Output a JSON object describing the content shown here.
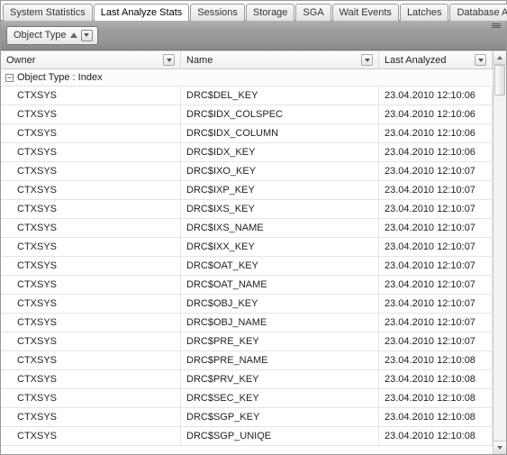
{
  "tabs": [
    {
      "label": "System Statistics",
      "active": false
    },
    {
      "label": "Last Analyze Stats",
      "active": true
    },
    {
      "label": "Sessions",
      "active": false
    },
    {
      "label": "Storage",
      "active": false
    },
    {
      "label": "SGA",
      "active": false
    },
    {
      "label": "Wait Events",
      "active": false
    },
    {
      "label": "Latches",
      "active": false
    },
    {
      "label": "Database Alerts",
      "active": false
    }
  ],
  "toolbar": {
    "group_button_label": "Object Type"
  },
  "columns": {
    "owner": "Owner",
    "name": "Name",
    "last_analyzed": "Last Analyzed"
  },
  "group": {
    "header": "Object Type : Index",
    "collapse_glyph": "⊟"
  },
  "rows": [
    {
      "owner": "CTXSYS",
      "name": "DRC$DEL_KEY",
      "last": "23.04.2010 12:10:06"
    },
    {
      "owner": "CTXSYS",
      "name": "DRC$IDX_COLSPEC",
      "last": "23.04.2010 12:10:06"
    },
    {
      "owner": "CTXSYS",
      "name": "DRC$IDX_COLUMN",
      "last": "23.04.2010 12:10:06"
    },
    {
      "owner": "CTXSYS",
      "name": "DRC$IDX_KEY",
      "last": "23.04.2010 12:10:06"
    },
    {
      "owner": "CTXSYS",
      "name": "DRC$IXO_KEY",
      "last": "23.04.2010 12:10:07"
    },
    {
      "owner": "CTXSYS",
      "name": "DRC$IXP_KEY",
      "last": "23.04.2010 12:10:07"
    },
    {
      "owner": "CTXSYS",
      "name": "DRC$IXS_KEY",
      "last": "23.04.2010 12:10:07"
    },
    {
      "owner": "CTXSYS",
      "name": "DRC$IXS_NAME",
      "last": "23.04.2010 12:10:07"
    },
    {
      "owner": "CTXSYS",
      "name": "DRC$IXX_KEY",
      "last": "23.04.2010 12:10:07"
    },
    {
      "owner": "CTXSYS",
      "name": "DRC$OAT_KEY",
      "last": "23.04.2010 12:10:07"
    },
    {
      "owner": "CTXSYS",
      "name": "DRC$OAT_NAME",
      "last": "23.04.2010 12:10:07"
    },
    {
      "owner": "CTXSYS",
      "name": "DRC$OBJ_KEY",
      "last": "23.04.2010 12:10:07"
    },
    {
      "owner": "CTXSYS",
      "name": "DRC$OBJ_NAME",
      "last": "23.04.2010 12:10:07"
    },
    {
      "owner": "CTXSYS",
      "name": "DRC$PRE_KEY",
      "last": "23.04.2010 12:10:07"
    },
    {
      "owner": "CTXSYS",
      "name": "DRC$PRE_NAME",
      "last": "23.04.2010 12:10:08"
    },
    {
      "owner": "CTXSYS",
      "name": "DRC$PRV_KEY",
      "last": "23.04.2010 12:10:08"
    },
    {
      "owner": "CTXSYS",
      "name": "DRC$SEC_KEY",
      "last": "23.04.2010 12:10:08"
    },
    {
      "owner": "CTXSYS",
      "name": "DRC$SGP_KEY",
      "last": "23.04.2010 12:10:08"
    },
    {
      "owner": "CTXSYS",
      "name": "DRC$SGP_UNIQE",
      "last": "23.04.2010 12:10:08"
    }
  ]
}
